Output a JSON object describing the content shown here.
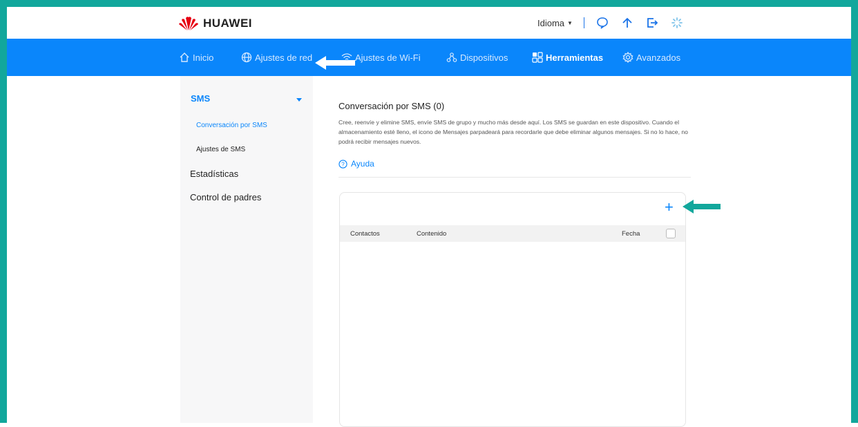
{
  "colors": {
    "frame": "#12a79c",
    "nav_bg": "#0a86fb",
    "accent": "#0a86fb",
    "logo_red": "#e60012",
    "annotation_arrow": "#12a79c"
  },
  "header": {
    "brand": "HUAWEI",
    "language_label": "Idioma",
    "icons": [
      "chevron-down-icon",
      "chat-bubble-icon",
      "upload-arrow-icon",
      "logout-icon",
      "loading-icon"
    ]
  },
  "nav": {
    "items": [
      {
        "label": "Inicio",
        "icon": "home-icon"
      },
      {
        "label": "Ajustes de red",
        "icon": "globe-icon"
      },
      {
        "label": "Ajustes de Wi-Fi",
        "icon": "wifi-icon"
      },
      {
        "label": "Dispositivos",
        "icon": "devices-icon"
      },
      {
        "label": "Herramientas",
        "icon": "tools-icon",
        "active": true
      },
      {
        "label": "Avanzados",
        "icon": "gear-icon"
      }
    ]
  },
  "sidebar": {
    "sms": "SMS",
    "sms_items": [
      "Conversación por SMS",
      "Ajustes de SMS"
    ],
    "items": [
      "Estadísticas",
      "Control de padres"
    ]
  },
  "main": {
    "title": "Conversación por SMS (0)",
    "description": "Cree, reenvíe y elimine SMS, envíe SMS de grupo y mucho más desde aquí. Los SMS se guardan en este dispositivo. Cuando el almacenamiento esté lleno, el icono de Mensajes parpadeará para recordarle que debe eliminar algunos mensajes. Si no lo hace, no podrá recibir mensajes nuevos.",
    "help": "Ayuda",
    "add": "+",
    "table": {
      "columns": [
        "Contactos",
        "Contenido",
        "Fecha"
      ]
    }
  }
}
